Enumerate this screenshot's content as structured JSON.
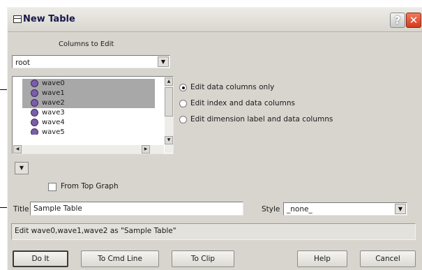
{
  "window": {
    "title": "New Table",
    "help_glyph": "?",
    "close_glyph": "✕"
  },
  "columns": {
    "heading": "Columns to Edit",
    "folder_value": "root",
    "items": [
      {
        "label": "wave0",
        "selected": true
      },
      {
        "label": "wave1",
        "selected": true
      },
      {
        "label": "wave2",
        "selected": true
      },
      {
        "label": "wave3",
        "selected": false
      },
      {
        "label": "wave4",
        "selected": false
      },
      {
        "label": "wave5",
        "selected": false
      }
    ]
  },
  "options": {
    "radio_data_only": "Edit data columns only",
    "radio_index_data": "Edit index and data columns",
    "radio_dimension": "Edit dimension label and data columns",
    "selected": "radio_data_only",
    "from_top_graph": "From Top Graph",
    "from_top_graph_checked": false
  },
  "title_field": {
    "label": "Title",
    "value": "Sample Table"
  },
  "style_field": {
    "label": "Style",
    "value": "_none_"
  },
  "command_line": "Edit wave0,wave1,wave2 as \"Sample Table\"",
  "buttons": {
    "do_it": "Do It",
    "to_cmd_line": "To Cmd Line",
    "to_clip": "To Clip",
    "help": "Help",
    "cancel": "Cancel"
  },
  "icons": {
    "dropdown": "▼",
    "scroll_up": "▲",
    "scroll_down": "▼",
    "scroll_left": "◀",
    "scroll_right": "▶",
    "wave": "wave-icon",
    "table": "table-icon"
  },
  "colors": {
    "dialog_bg": "#d8d5cf",
    "selection": "#a8a8a8",
    "close_red": "#d23b1c",
    "wave_purple": "#7a5ea6"
  }
}
